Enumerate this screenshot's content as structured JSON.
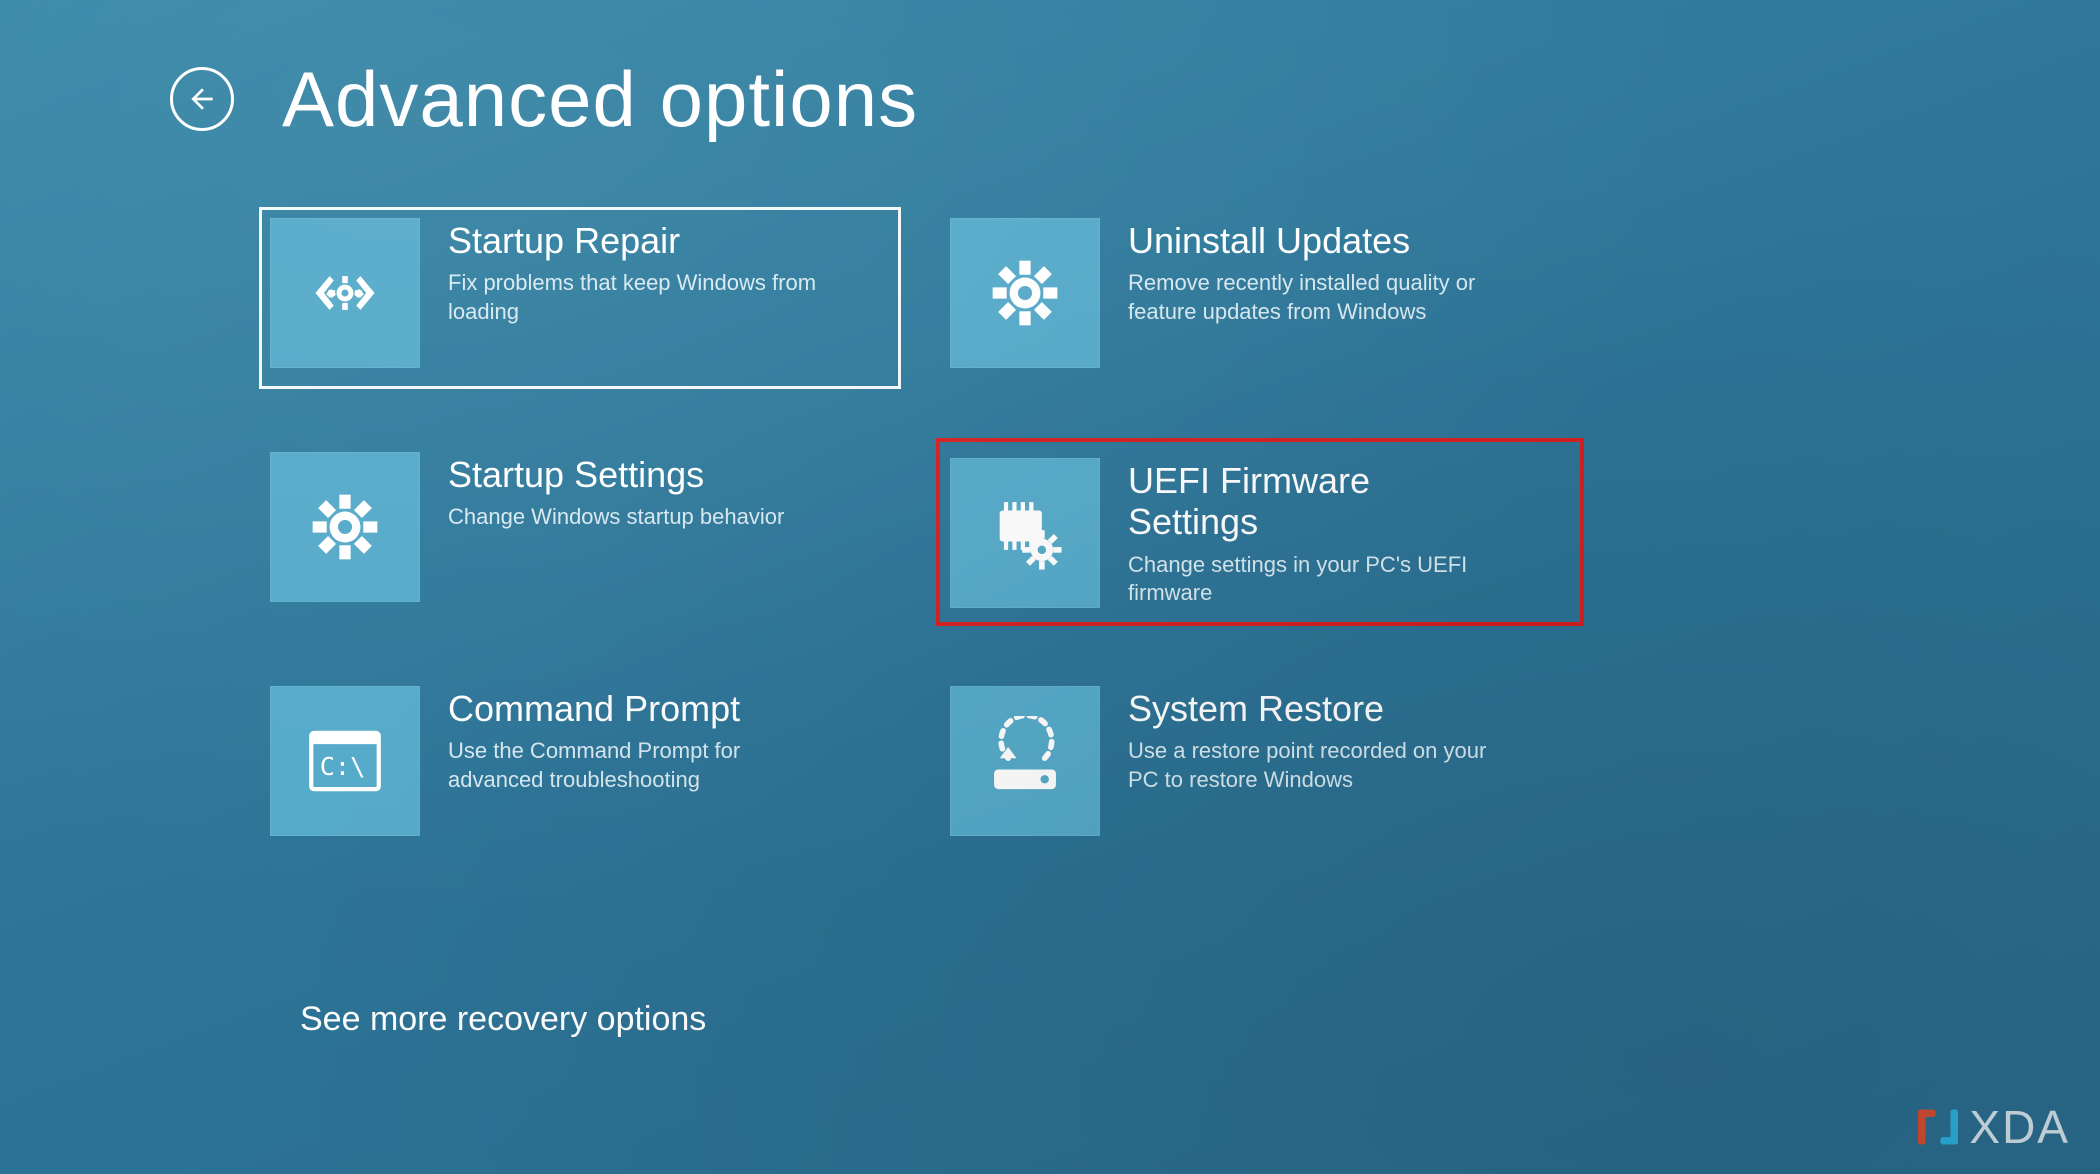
{
  "header": {
    "title": "Advanced options"
  },
  "tiles": {
    "startup_repair": {
      "title": "Startup Repair",
      "desc": "Fix problems that keep Windows from loading"
    },
    "uninstall_updates": {
      "title": "Uninstall Updates",
      "desc": "Remove recently installed quality or feature updates from Windows"
    },
    "startup_settings": {
      "title": "Startup Settings",
      "desc": "Change Windows startup behavior"
    },
    "uefi": {
      "title": "UEFI Firmware Settings",
      "desc": "Change settings in your PC's UEFI firmware"
    },
    "cmd": {
      "title": "Command Prompt",
      "desc": "Use the Command Prompt for advanced troubleshooting"
    },
    "system_restore": {
      "title": "System Restore",
      "desc": "Use a restore point recorded on your PC to restore Windows"
    }
  },
  "more_link": "See more recovery options",
  "watermark": "XDA",
  "colors": {
    "background_top": "#3788a8",
    "background_bottom": "#2a6b8d",
    "tile_bg": "#55aac9",
    "highlight_border": "#d62020"
  }
}
